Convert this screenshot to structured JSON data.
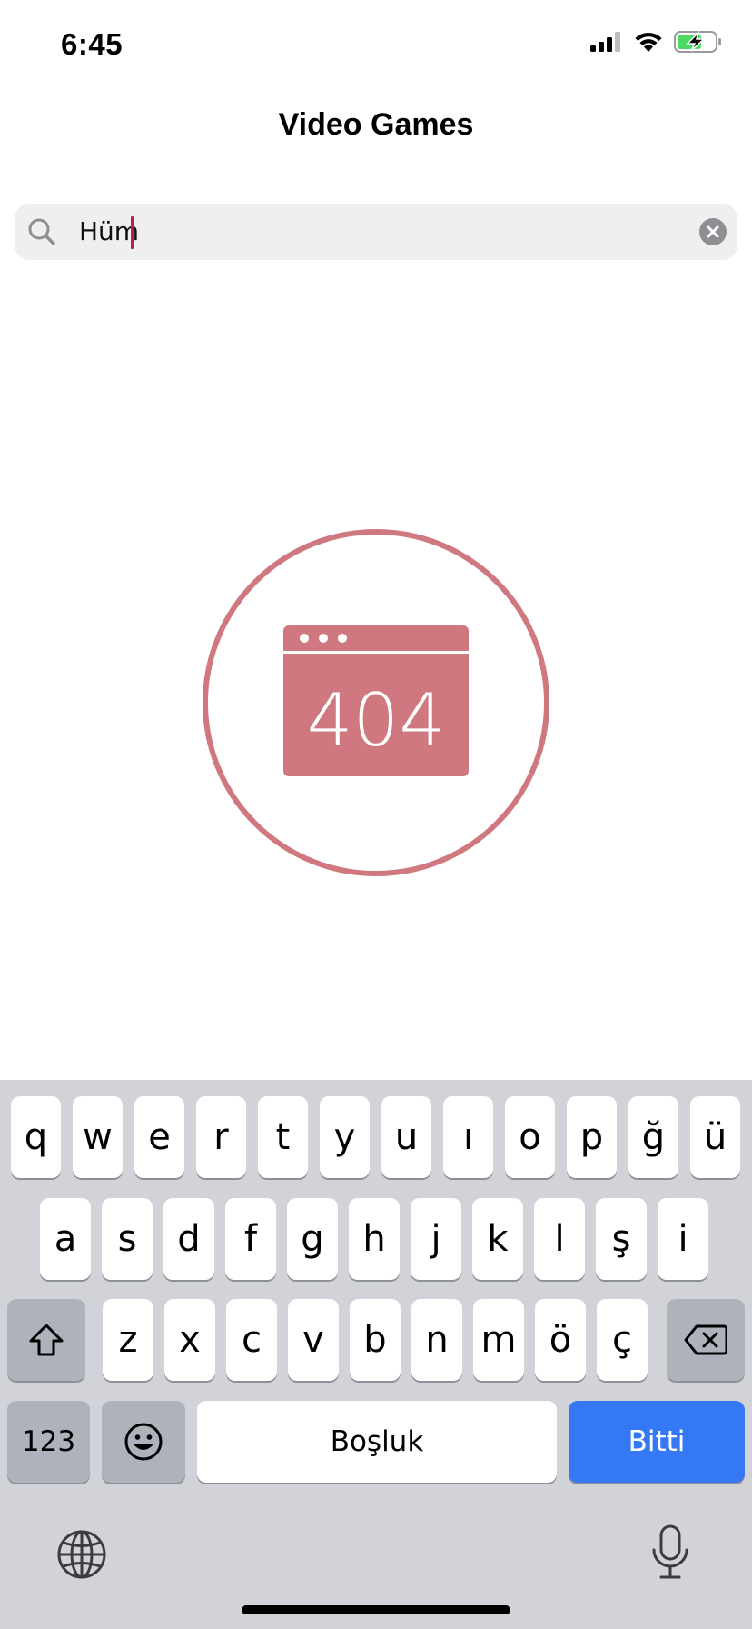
{
  "status_bar": {
    "time": "6:45",
    "icons": [
      "cellular-signal-icon",
      "wifi-icon",
      "battery-charging-icon"
    ]
  },
  "nav": {
    "title": "Video Games"
  },
  "search": {
    "value": "Hüm",
    "icon": "search-icon",
    "clear_icon": "clear-icon"
  },
  "error": {
    "code": "404",
    "icon": "browser-window-icon",
    "color": "#d0787f"
  },
  "keyboard": {
    "row1": [
      "q",
      "w",
      "e",
      "r",
      "t",
      "y",
      "u",
      "ı",
      "o",
      "p",
      "ğ",
      "ü"
    ],
    "row2": [
      "a",
      "s",
      "d",
      "f",
      "g",
      "h",
      "j",
      "k",
      "l",
      "ş",
      "i"
    ],
    "row3": [
      "z",
      "x",
      "c",
      "v",
      "b",
      "n",
      "m",
      "ö",
      "ç"
    ],
    "numbers_label": "123",
    "space_label": "Boşluk",
    "done_label": "Bitti",
    "done_color": "#3478f6",
    "icons": [
      "shift-icon",
      "delete-icon",
      "emoji-icon",
      "globe-icon",
      "microphone-icon"
    ]
  }
}
